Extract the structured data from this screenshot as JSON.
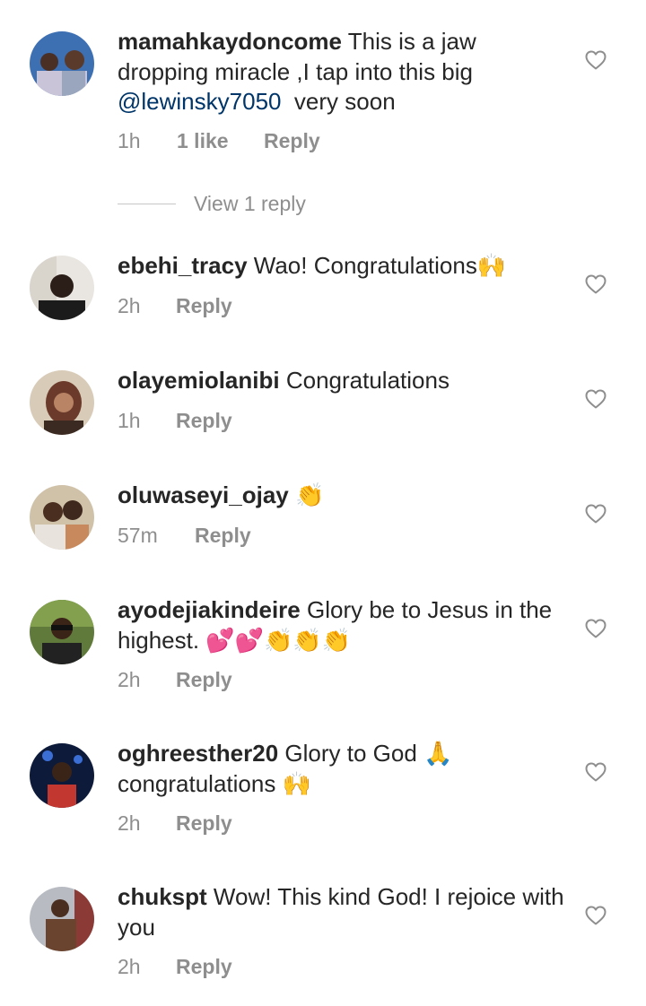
{
  "comments": [
    {
      "username": "mamahkaydoncome",
      "text": "This is a jaw dropping miracle ,I tap into this big",
      "mention": "@lewinsky7050",
      "text_after": "  very soon",
      "time": "1h",
      "likes": "1 like",
      "reply": "Reply"
    },
    {
      "username": "ebehi_tracy",
      "text": "Wao! Congratulations🙌",
      "time": "2h",
      "reply": "Reply"
    },
    {
      "username": "olayemiolanibi",
      "text": "Congratulations",
      "time": "1h",
      "reply": "Reply"
    },
    {
      "username": "oluwaseyi_ojay",
      "text": "👏",
      "time": "57m",
      "reply": "Reply"
    },
    {
      "username": "ayodejiakindeire",
      "text": "Glory be to Jesus in the highest. 💕💕👏👏👏",
      "time": "2h",
      "reply": "Reply"
    },
    {
      "username": "oghreesther20",
      "text": "Glory to God 🙏 congratulations 🙌",
      "time": "2h",
      "reply": "Reply"
    },
    {
      "username": "chukspt",
      "text": "Wow! This kind God! I rejoice with you",
      "time": "2h",
      "reply": "Reply"
    }
  ],
  "view_replies": "View 1 reply",
  "colors": {
    "text": "#262626",
    "meta": "#8e8e8e",
    "mention": "#003569",
    "heart": "#8e8e8e"
  }
}
